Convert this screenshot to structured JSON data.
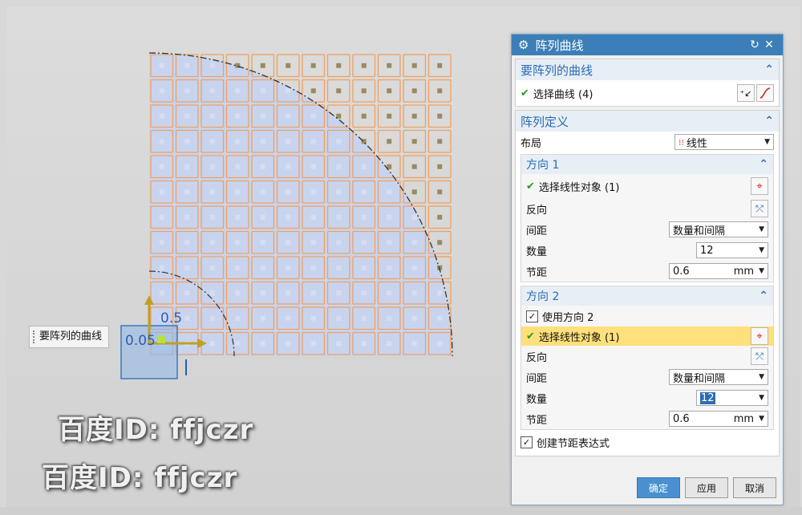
{
  "viewport": {
    "grid_rows": 12,
    "grid_cols": 12,
    "curve_label": "要阵列的曲线",
    "dim_label_1": "0.5",
    "dim_label_2": "0.05",
    "colors": {
      "grid": "#f0a060",
      "fill": "#c8d4ee",
      "arc": "#333333",
      "dot": "#9a8a60"
    }
  },
  "watermarks": [
    "百度ID: ffjczr",
    "百度ID: ffjczr"
  ],
  "dialog": {
    "title": "阵列曲线",
    "reset_icon": "reset-icon",
    "close_icon": "close-icon",
    "curves_section": {
      "title": "要阵列的曲线",
      "select_label": "选择曲线 (4)"
    },
    "pattern_section": {
      "title": "阵列定义",
      "layout_label": "布局",
      "layout_value": "线性",
      "dir1": {
        "title": "方向 1",
        "select_label": "选择线性对象 (1)",
        "reverse_label": "反向",
        "spacing_label": "间距",
        "spacing_value": "数量和间隔",
        "count_label": "数量",
        "count_value": "12",
        "pitch_label": "节距",
        "pitch_value": "0.6",
        "pitch_unit": "mm"
      },
      "dir2": {
        "title": "方向 2",
        "use_label": "使用方向 2",
        "select_label": "选择线性对象 (1)",
        "reverse_label": "反向",
        "spacing_label": "间距",
        "spacing_value": "数量和间隔",
        "count_label": "数量",
        "count_value": "12",
        "pitch_label": "节距",
        "pitch_value": "0.6",
        "pitch_unit": "mm"
      },
      "create_expr_label": "创建节距表达式"
    },
    "buttons": {
      "ok": "确定",
      "apply": "应用",
      "cancel": "取消"
    }
  }
}
